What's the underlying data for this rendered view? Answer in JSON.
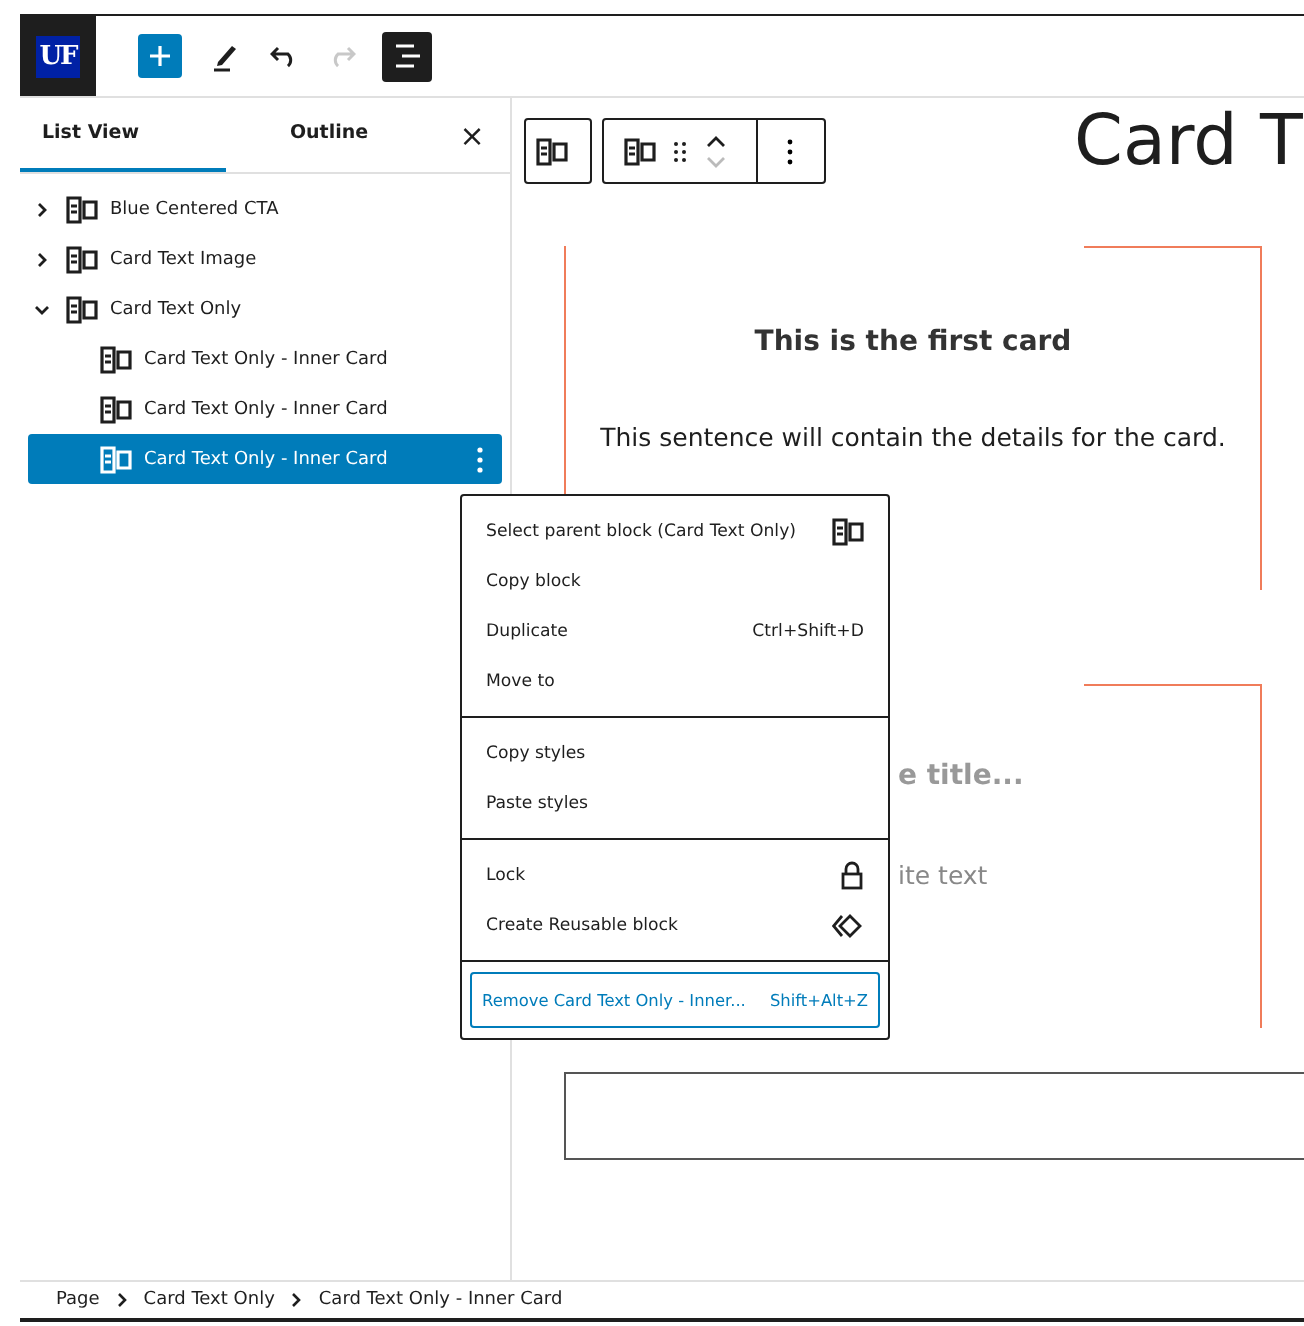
{
  "logo": {
    "text": "UF"
  },
  "toolbar": {
    "redo_disabled": true,
    "list_view_on": true
  },
  "sidebar": {
    "tabs": [
      {
        "label": "List View",
        "selected": true
      },
      {
        "label": "Outline",
        "selected": false
      }
    ],
    "close": "×",
    "items": [
      {
        "label": "Blue Centered CTA",
        "expanded": false,
        "selected": false
      },
      {
        "label": "Card Text Image",
        "expanded": false,
        "selected": false
      },
      {
        "label": "Card Text Only",
        "expanded": true,
        "selected": false,
        "children": [
          {
            "label": "Card Text Only - Inner Card",
            "selected": false
          },
          {
            "label": "Card Text Only - Inner Card",
            "selected": false
          },
          {
            "label": "Card Text Only - Inner Card",
            "selected": true
          }
        ]
      }
    ]
  },
  "canvas": {
    "page_title": "Card T",
    "cards": [
      {
        "title": "This is the first card",
        "body": "This sentence will contain the details for the card.",
        "placeholder": false
      },
      {
        "title": "e title...",
        "body": "ite text",
        "placeholder": true
      }
    ]
  },
  "menu": {
    "groups": [
      [
        {
          "label": "Select parent block (Card Text Only)"
        },
        {
          "label": "Copy block"
        },
        {
          "label": "Duplicate",
          "shortcut": "Ctrl+Shift+D"
        },
        {
          "label": "Move to"
        }
      ],
      [
        {
          "label": "Copy styles"
        },
        {
          "label": "Paste styles"
        }
      ],
      [
        {
          "label": "Lock"
        },
        {
          "label": "Create Reusable block"
        }
      ],
      [
        {
          "label": "Remove Card Text Only - Inner...",
          "shortcut": "Shift+Alt+Z",
          "focused": true
        }
      ]
    ]
  },
  "breadcrumb": [
    "Page",
    "Card Text Only",
    "Card Text Only - Inner Card"
  ]
}
